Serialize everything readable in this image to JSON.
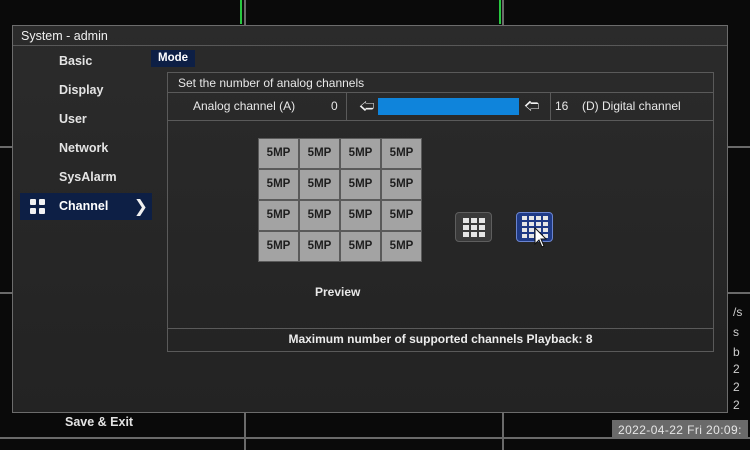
{
  "window": {
    "title": "System - admin"
  },
  "sidebar": {
    "items": [
      {
        "label": "Basic"
      },
      {
        "label": "Display"
      },
      {
        "label": "User"
      },
      {
        "label": "Network"
      },
      {
        "label": "SysAlarm"
      },
      {
        "label": "Channel",
        "active": true
      }
    ],
    "save_exit_label": "Save & Exit"
  },
  "tab": {
    "label": "Mode"
  },
  "channels": {
    "heading": "Set the number of analog channels",
    "analog_label": "Analog channel (A)",
    "analog_value": "0",
    "digital_value": "16",
    "digital_label": "(D) Digital channel",
    "slider_fraction": 0.0
  },
  "preview": {
    "cells": [
      "5MP",
      "5MP",
      "5MP",
      "5MP",
      "5MP",
      "5MP",
      "5MP",
      "5MP",
      "5MP",
      "5MP",
      "5MP",
      "5MP",
      "5MP",
      "5MP",
      "5MP",
      "5MP"
    ],
    "label": "Preview"
  },
  "footer": {
    "text": "Maximum number of supported channels Playback: 8"
  },
  "status": {
    "datetime": "2022-04-22 Fri 20:09:"
  },
  "colors": {
    "accent": "#0f84db",
    "selected": "#0d1f45",
    "panel": "#262626"
  }
}
